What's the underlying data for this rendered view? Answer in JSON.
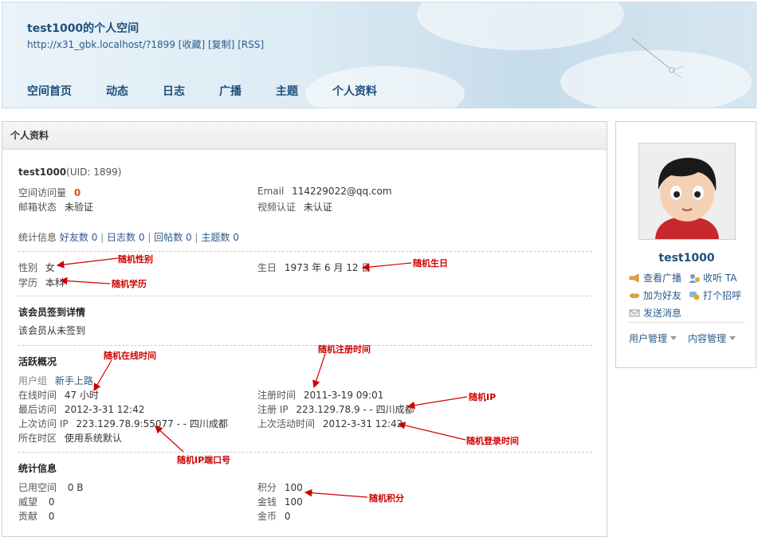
{
  "header": {
    "title": "test1000的个人空间",
    "url": "http://x31_gbk.localhost/?1899",
    "links": [
      "[收藏]",
      "[复制]",
      "[RSS]"
    ],
    "nav": [
      "空间首页",
      "动态",
      "日志",
      "广播",
      "主题",
      "个人资料"
    ]
  },
  "panel": {
    "title": "个人资料",
    "username": "test1000",
    "uid": "(UID: 1899)",
    "visits_label": "空间访问量",
    "visits_value": "0",
    "email_label": "Email",
    "email_value": "114229022@qq.com",
    "mail_status_label": "邮箱状态",
    "mail_status_value": "未验证",
    "video_label": "视频认证",
    "video_value": "未认证",
    "stats_label": "统计信息",
    "stats": [
      {
        "label": "好友数",
        "value": "0"
      },
      {
        "label": "日志数",
        "value": "0"
      },
      {
        "label": "回帖数",
        "value": "0"
      },
      {
        "label": "主题数",
        "value": "0"
      }
    ],
    "gender_label": "性别",
    "gender_value": "女",
    "birthday_label": "生日",
    "birthday_value": "1973 年 6 月 12 日",
    "edu_label": "学历",
    "edu_value": "本科",
    "signin_title": "该会员签到详情",
    "signin_text": "该会员从未签到",
    "activity_title": "活跃概况",
    "group_label": "用户组",
    "group_value": "新手上路",
    "online_label": "在线时间",
    "online_value": "47 小时",
    "regtime_label": "注册时间",
    "regtime_value": "2011-3-19 09:01",
    "lastvisit_label": "最后访问",
    "lastvisit_value": "2012-3-31 12:42",
    "regip_label": "注册 IP",
    "regip_value": "223.129.78.9 - - 四川成都",
    "lastip_label": "上次访问 IP",
    "lastip_value": "223.129.78.9:55077 - - 四川成都",
    "lastactive_label": "上次活动时间",
    "lastactive_value": "2012-3-31 12:42",
    "timezone_label": "所在时区",
    "timezone_value": "使用系统默认",
    "stat_title": "统计信息",
    "space_label": "已用空间",
    "space_value": "0 B",
    "credits_label": "积分",
    "credits_value": "100",
    "prestige_label": "威望",
    "prestige_value": "0",
    "money_label": "金钱",
    "money_value": "100",
    "contrib_label": "贡献",
    "contrib_value": "0",
    "gold_label": "金币",
    "gold_value": "0"
  },
  "annotations": {
    "gender": "随机性别",
    "birthday": "随机生日",
    "edu": "随机学历",
    "online": "随机在线时间",
    "regtime": "随机注册时间",
    "ip": "随机IP",
    "login_time": "随机登录时间",
    "ip_port": "随机IP端口号",
    "credits": "随机积分",
    "color": "#d00000"
  },
  "sidebar": {
    "name": "test1000",
    "actions": [
      "查看广播",
      "收听 TA",
      "加为好友",
      "打个招呼",
      "发送消息"
    ],
    "menus": [
      "用户管理",
      "内容管理"
    ]
  }
}
